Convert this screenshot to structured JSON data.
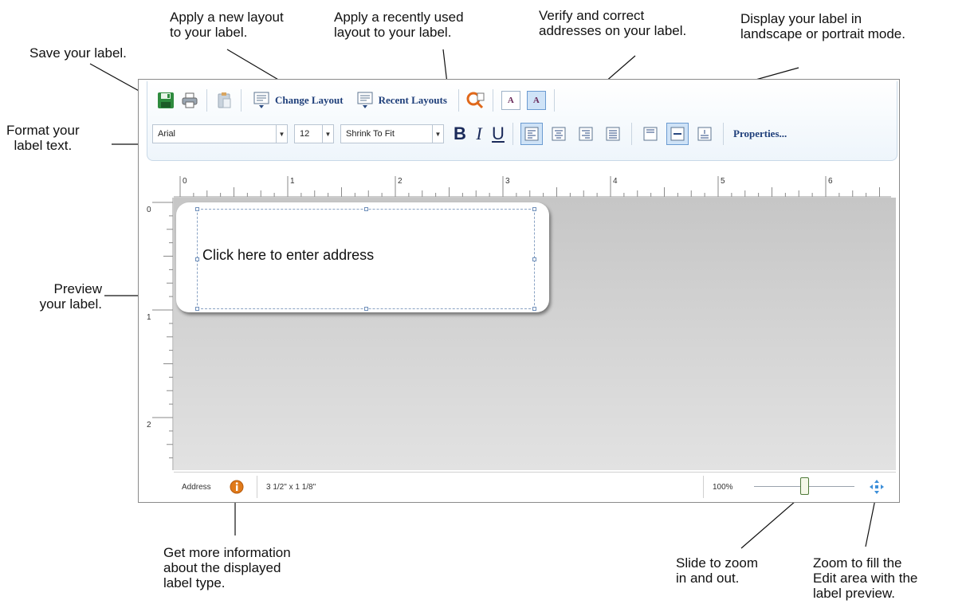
{
  "callouts": {
    "save": "Save your label.",
    "change_layout": "Apply a new layout\nto your label.",
    "recent_layouts": "Apply a recently used\nlayout to your label.",
    "verify": "Verify and correct\naddresses on your label.",
    "orientation": "Display your label in\nlandscape or portrait mode.",
    "format": "Format your\nlabel text.",
    "preview": "Preview\nyour label.",
    "info": "Get more information\nabout the displayed\nlabel type.",
    "zoom_slider": "Slide to zoom\nin and out.",
    "zoom_fill": "Zoom to fill the\nEdit area with the\nlabel preview."
  },
  "toolbar": {
    "change_layout_label": "Change Layout",
    "recent_layouts_label": "Recent Layouts",
    "orientation_glyph": "A",
    "font_name": "Arial",
    "font_size": "12",
    "fit_mode": "Shrink To Fit",
    "bold_glyph": "B",
    "italic_glyph": "I",
    "underline_glyph": "U",
    "properties_label": "Properties..."
  },
  "ruler": {
    "h_labels": [
      "0",
      "1",
      "2",
      "3",
      "4",
      "5",
      "6"
    ],
    "v_labels": [
      "0",
      "1",
      "2"
    ]
  },
  "label": {
    "placeholder": "Click here to enter address"
  },
  "status": {
    "label_type": "Address",
    "label_size": "3 1/2\" x 1 1/8\"",
    "zoom_level": "100%",
    "zoom_value": 0.5
  },
  "colors": {
    "accent": "#1f3f7a",
    "selection": "#6b9bd1",
    "info_badge": "#e07a1a",
    "zoom_fill_icon": "#3d8fd9"
  }
}
